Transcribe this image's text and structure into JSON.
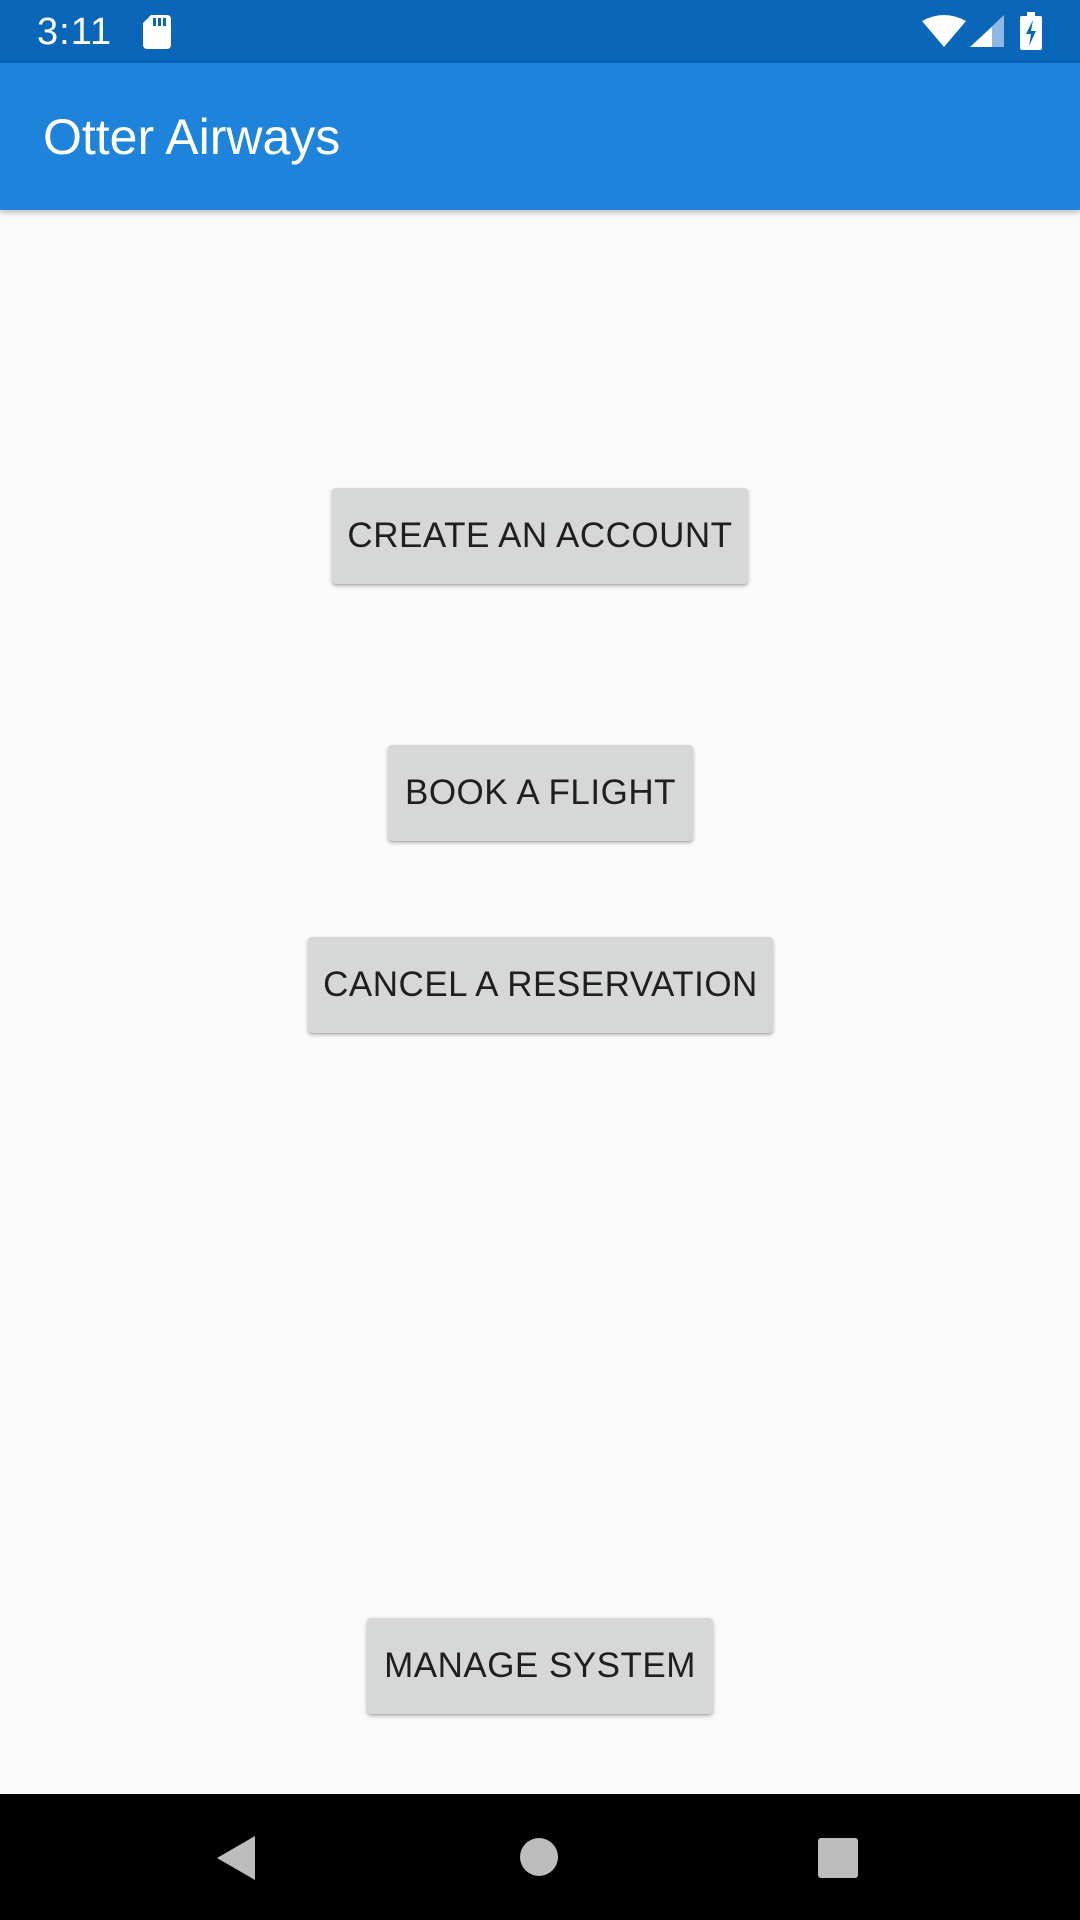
{
  "status_bar": {
    "time": "3:11",
    "icons": [
      "sd-card-icon",
      "wifi-icon",
      "cell-signal-icon",
      "battery-charging-icon"
    ]
  },
  "app_bar": {
    "title": "Otter Airways"
  },
  "main": {
    "buttons": [
      {
        "label": "CREATE AN ACCOUNT"
      },
      {
        "label": "BOOK A FLIGHT"
      },
      {
        "label": "CANCEL A RESERVATION"
      },
      {
        "label": "MANAGE SYSTEM"
      }
    ]
  },
  "nav_bar": {
    "icons": [
      "back-icon",
      "home-icon",
      "recents-icon"
    ]
  },
  "colors": {
    "status_bar": "#0966b8",
    "app_bar": "#1e83da",
    "background": "#fafafa",
    "button": "#d6d7d7",
    "nav_bar": "#000000"
  }
}
